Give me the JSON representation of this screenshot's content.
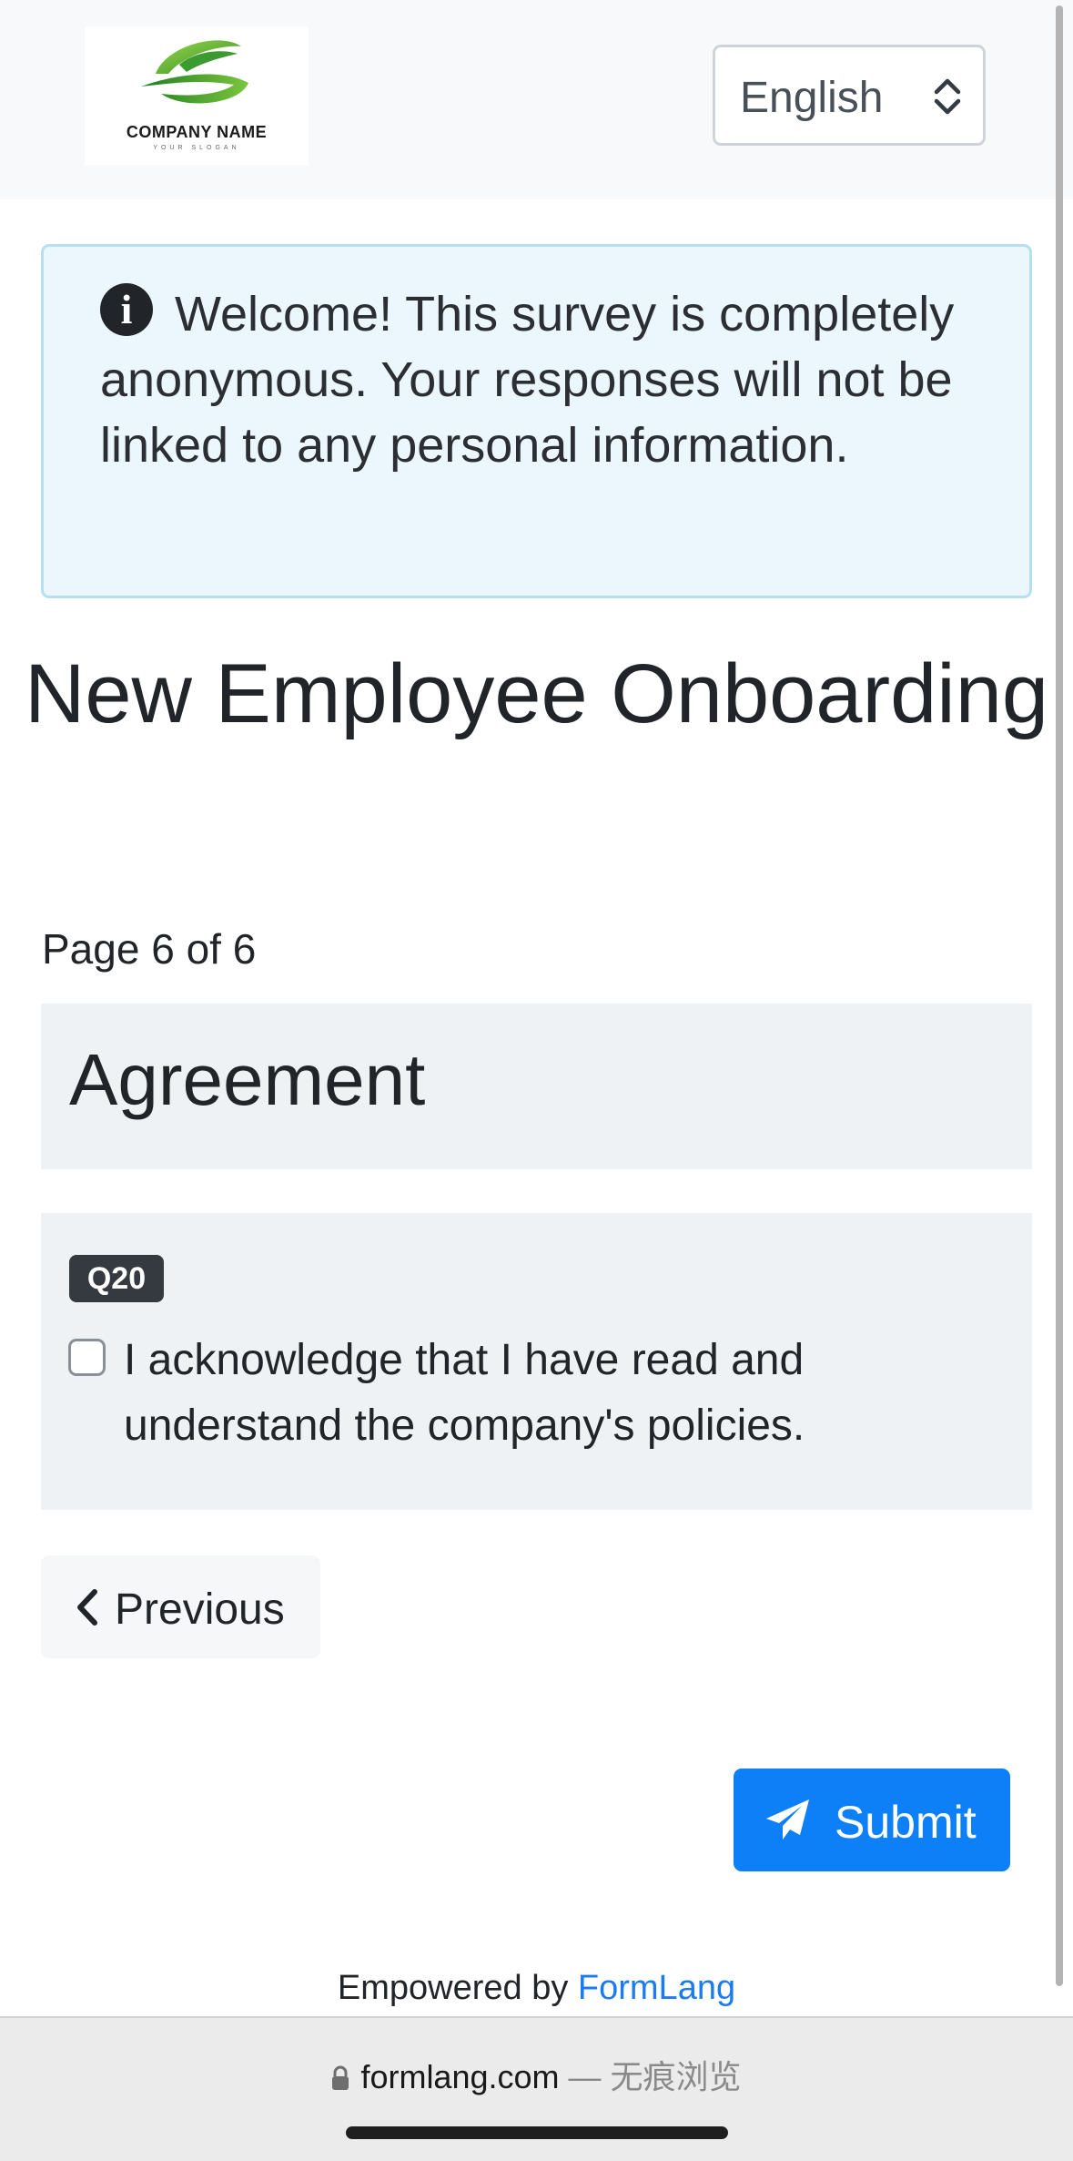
{
  "header": {
    "logo": {
      "company_name": "COMPANY NAME",
      "slogan": "YOUR SLOGAN"
    },
    "language_select": {
      "value": "English"
    }
  },
  "alert": {
    "icon": "info-circle-icon",
    "text": "Welcome! This survey is completely anonymous. Your responses will not be linked to any personal information."
  },
  "survey": {
    "title": "New Employee Onboarding",
    "page_indicator": "Page 6 of 6",
    "progress": {
      "current_page": 6,
      "total_pages": 6
    },
    "section_title": "Agreement",
    "question": {
      "badge": "Q20",
      "label": "I acknowledge that I have read and understand the company's policies.",
      "checked": false
    }
  },
  "nav": {
    "previous_label": "Previous",
    "previous_icon": "chevron-left-icon",
    "submit_label": "Submit",
    "submit_icon": "paper-plane-icon"
  },
  "footer": {
    "prefix": "Empowered by",
    "link_text": "FormLang"
  },
  "browser": {
    "url": "formlang.com",
    "mode_text": "— 无痕浏览"
  },
  "colors": {
    "primary": "#0d80f8",
    "alert_bg": "#ebf6fd",
    "alert_border": "#b6e0f0",
    "section_bg": "#eef2f5",
    "badge_bg": "#343a40",
    "link": "#1a7cf0"
  }
}
